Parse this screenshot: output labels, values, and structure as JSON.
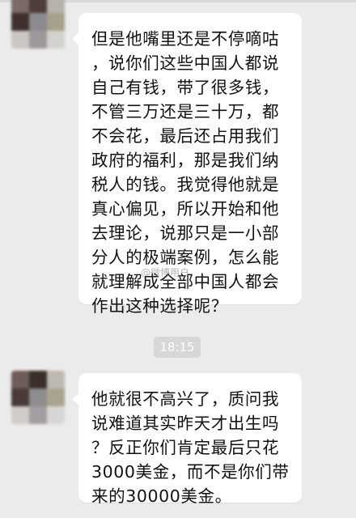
{
  "messages": [
    {
      "text": "但是他嘴里还是不停嘀咕\n，说你们这些中国人都说\n自己有钱，带了很多钱，\n不管三万还是三十万，都\n不会花，最后还占用我们\n政府的福利，那是我们纳\n税人的钱。我觉得他就是\n真心偏见，所以开始和他\n去理论，说那只是一小部\n分人的极端案例，怎么能\n就理解成全部中国人都会\n作出这种选择呢？"
    },
    {
      "text": "他就很不高兴了，质问我\n说难道其实昨天才出生吗\n？反正你们肯定最后只花\n3000美金，而不是你们带\n来的30000美金。"
    }
  ],
  "timestamp": "18:15",
  "watermark": "@微博用户",
  "colors": {
    "background": "#ebebeb",
    "bubble": "#ffffff",
    "timestamp_bg": "#d7d7d7",
    "timestamp_text": "#ffffff",
    "text": "#111111"
  }
}
